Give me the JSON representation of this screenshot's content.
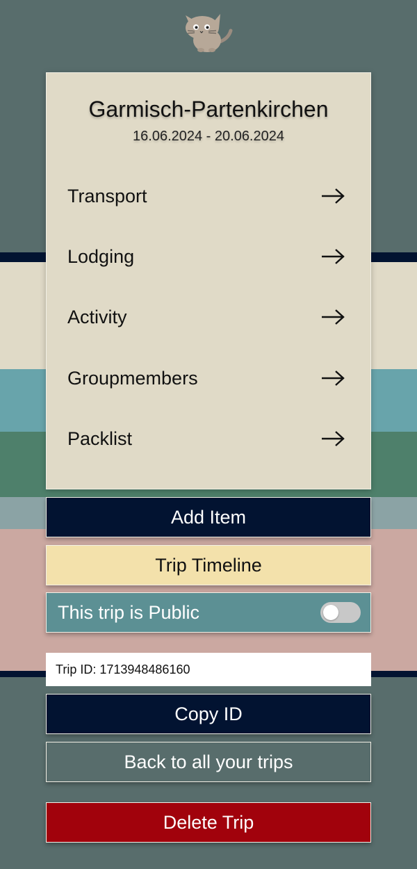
{
  "trip": {
    "title": "Garmisch-Partenkirchen",
    "dates": "16.06.2024 - 20.06.2024"
  },
  "menu": [
    {
      "label": "Transport",
      "icon": "arrow-right-icon"
    },
    {
      "label": "Lodging",
      "icon": "arrow-right-icon"
    },
    {
      "label": "Activity",
      "icon": "arrow-right-icon"
    },
    {
      "label": "Groupmembers",
      "icon": "arrow-right-icon"
    },
    {
      "label": "Packlist",
      "icon": "arrow-right-icon"
    }
  ],
  "buttons": {
    "add_item": "Add Item",
    "trip_timeline": "Trip Timeline",
    "copy_id": "Copy ID",
    "back": "Back to all your trips",
    "delete": "Delete Trip"
  },
  "public_toggle": {
    "label": "This trip is Public",
    "checked": false
  },
  "trip_id": {
    "text": "Trip ID: 1713948486160"
  },
  "colors": {
    "background": "#586d6c",
    "card": "#e0dac7",
    "navy": "#021331",
    "timeline": "#f3e1ab",
    "toggle_row": "#5c9094",
    "delete": "#a1020c",
    "band_beige": "#e0dac7",
    "band_teal": "#68a4ab",
    "band_green": "#4e806b",
    "band_grey": "#8ba3a5",
    "band_pink": "#cba8a1"
  }
}
